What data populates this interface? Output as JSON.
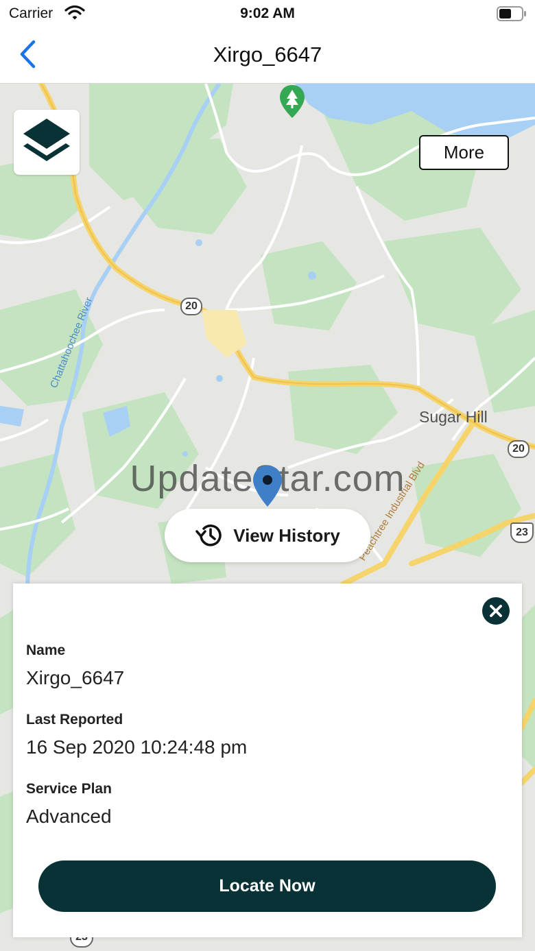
{
  "status_bar": {
    "carrier": "Carrier",
    "time": "9:02 AM",
    "icons": [
      "wifi-icon",
      "battery-icon"
    ]
  },
  "nav": {
    "title": "Xirgo_6647",
    "back_icon": "chevron-left-icon"
  },
  "map": {
    "labels": {
      "sugar_hill": "Sugar Hill",
      "river": "Chattahoochee River",
      "peachtree": "Peachtree Industrial Blvd"
    },
    "shields": {
      "route_20": "20",
      "route_23": "23"
    },
    "more_label": "More",
    "layers_icon": "layers-icon",
    "watermark": "UpdateStar.com",
    "view_history_label": "View History",
    "view_history_icon": "history-icon"
  },
  "card": {
    "name_label": "Name",
    "name_value": "Xirgo_6647",
    "last_reported_label": "Last Reported",
    "last_reported_value": "16 Sep 2020 10:24:48 pm",
    "service_plan_label": "Service Plan",
    "service_plan_value": "Advanced",
    "locate_label": "Locate Now",
    "close_icon": "close-icon"
  },
  "colors": {
    "accent": "#1a73e8",
    "primary_dark": "#083236",
    "map_base": "#e6e6e3",
    "map_green": "#c4e3c0",
    "water": "#a8d0f4",
    "highway": "#f5d46b"
  }
}
